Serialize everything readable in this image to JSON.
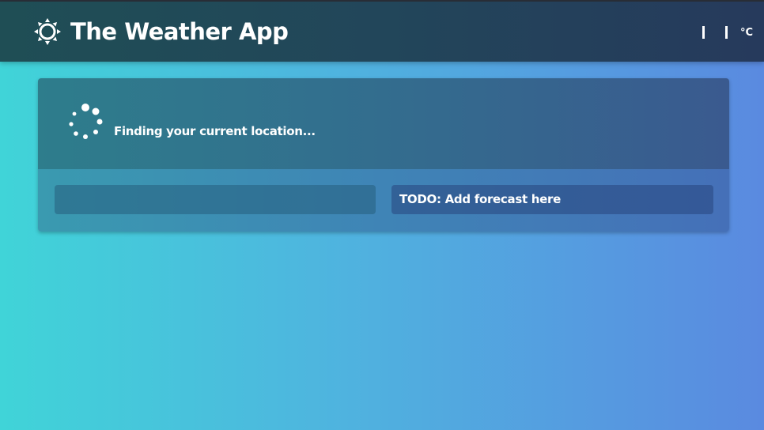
{
  "header": {
    "title": "The Weather App",
    "logo_icon": "sun-icon",
    "unit_label": "°C"
  },
  "status": {
    "spinner_icon": "loading-spinner-icon",
    "message": "Finding your current location..."
  },
  "panels": {
    "current": "",
    "forecast": "TODO: Add forecast here"
  },
  "colors": {
    "header_bg": "#22465a",
    "card_top_bg": "#336d8e",
    "card_bottom_bg": "#3f84b6",
    "page_gradient_start": "#40d4d8",
    "page_gradient_end": "#5a8ae0"
  }
}
